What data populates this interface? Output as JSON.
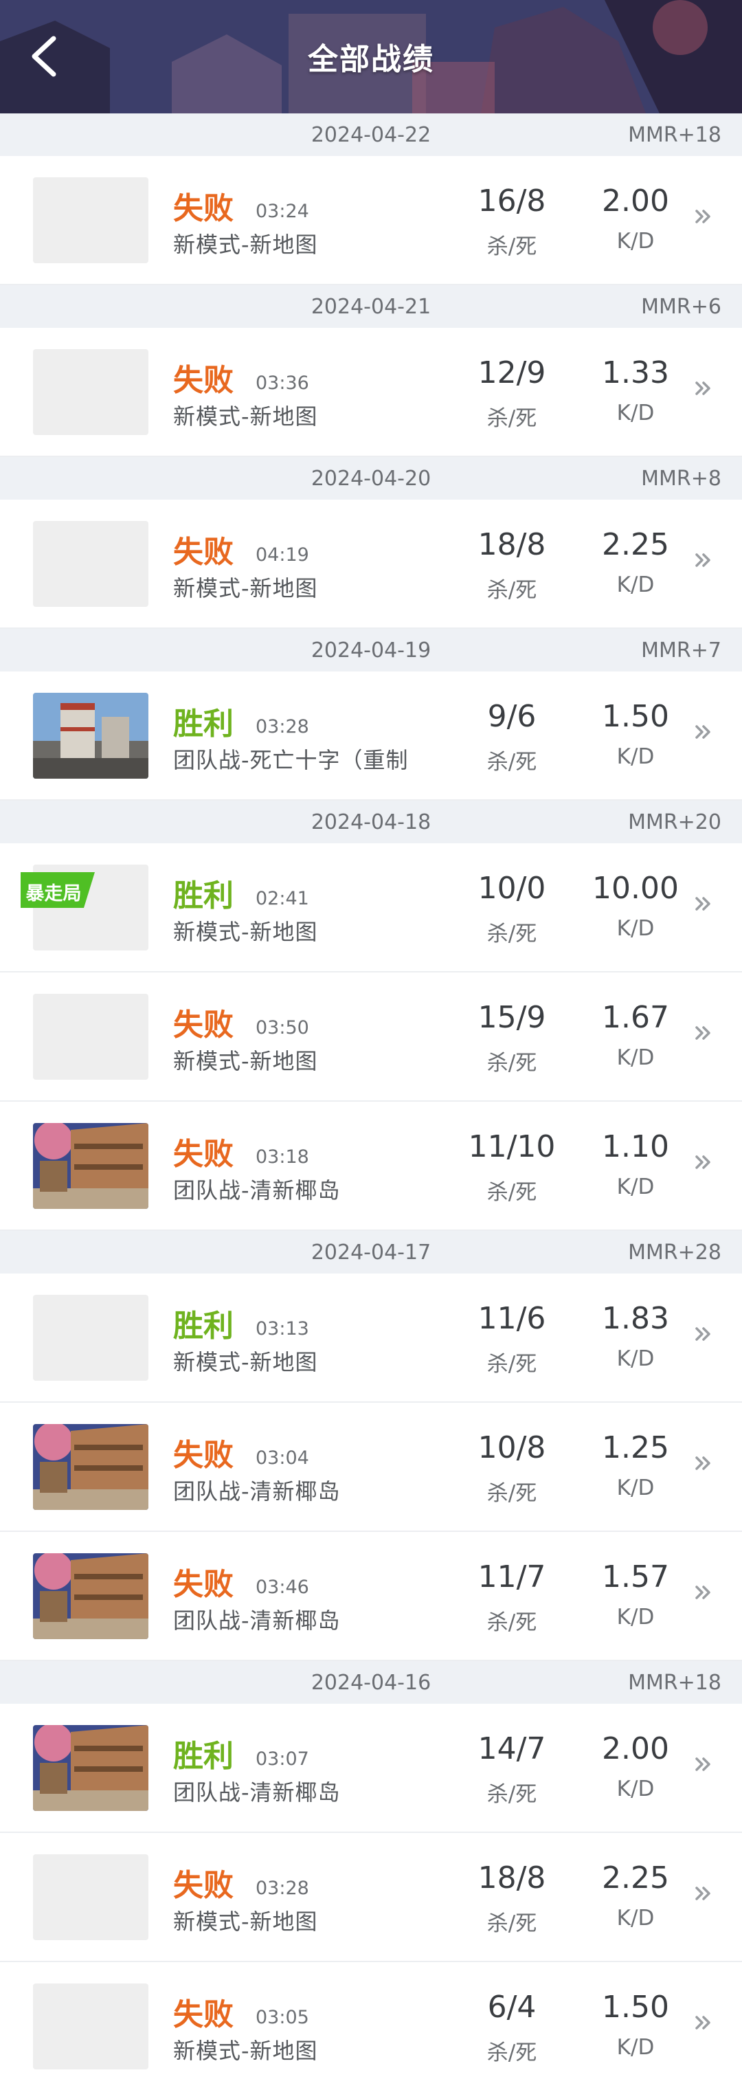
{
  "header": {
    "title": "全部战绩"
  },
  "stat_labels": {
    "kill_death": "杀/死",
    "kd": "K/D"
  },
  "colors": {
    "lose": "#e8681f",
    "win": "#6fb31f",
    "date_bg": "#eef1f5",
    "tag": "#4fbf24"
  },
  "days": [
    {
      "date": "2024-04-22",
      "mmr": "MMR+18",
      "matches": [
        {
          "result": "失败",
          "outcome": "lose",
          "duration": "03:24",
          "map": "新模式-新地图",
          "kd": "16/8",
          "ratio": "2.00",
          "thumb": "blank"
        }
      ]
    },
    {
      "date": "2024-04-21",
      "mmr": "MMR+6",
      "matches": [
        {
          "result": "失败",
          "outcome": "lose",
          "duration": "03:36",
          "map": "新模式-新地图",
          "kd": "12/9",
          "ratio": "1.33",
          "thumb": "blank"
        }
      ]
    },
    {
      "date": "2024-04-20",
      "mmr": "MMR+8",
      "matches": [
        {
          "result": "失败",
          "outcome": "lose",
          "duration": "04:19",
          "map": "新模式-新地图",
          "kd": "18/8",
          "ratio": "2.25",
          "thumb": "blank"
        }
      ]
    },
    {
      "date": "2024-04-19",
      "mmr": "MMR+7",
      "matches": [
        {
          "result": "胜利",
          "outcome": "win",
          "duration": "03:28",
          "map": "团队战-死亡十字（重制",
          "kd": "9/6",
          "ratio": "1.50",
          "thumb": "tower"
        }
      ]
    },
    {
      "date": "2024-04-18",
      "mmr": "MMR+20",
      "matches": [
        {
          "result": "胜利",
          "outcome": "win",
          "duration": "02:41",
          "map": "新模式-新地图",
          "kd": "10/0",
          "ratio": "10.00",
          "thumb": "blank",
          "tag": "暴走局"
        },
        {
          "result": "失败",
          "outcome": "lose",
          "duration": "03:50",
          "map": "新模式-新地图",
          "kd": "15/9",
          "ratio": "1.67",
          "thumb": "blank"
        },
        {
          "result": "失败",
          "outcome": "lose",
          "duration": "03:18",
          "map": "团队战-清新椰岛",
          "kd": "11/10",
          "ratio": "1.10",
          "thumb": "island"
        }
      ]
    },
    {
      "date": "2024-04-17",
      "mmr": "MMR+28",
      "matches": [
        {
          "result": "胜利",
          "outcome": "win",
          "duration": "03:13",
          "map": "新模式-新地图",
          "kd": "11/6",
          "ratio": "1.83",
          "thumb": "blank"
        },
        {
          "result": "失败",
          "outcome": "lose",
          "duration": "03:04",
          "map": "团队战-清新椰岛",
          "kd": "10/8",
          "ratio": "1.25",
          "thumb": "island"
        },
        {
          "result": "失败",
          "outcome": "lose",
          "duration": "03:46",
          "map": "团队战-清新椰岛",
          "kd": "11/7",
          "ratio": "1.57",
          "thumb": "island"
        }
      ]
    },
    {
      "date": "2024-04-16",
      "mmr": "MMR+18",
      "matches": [
        {
          "result": "胜利",
          "outcome": "win",
          "duration": "03:07",
          "map": "团队战-清新椰岛",
          "kd": "14/7",
          "ratio": "2.00",
          "thumb": "island"
        },
        {
          "result": "失败",
          "outcome": "lose",
          "duration": "03:28",
          "map": "新模式-新地图",
          "kd": "18/8",
          "ratio": "2.25",
          "thumb": "blank"
        },
        {
          "result": "失败",
          "outcome": "lose",
          "duration": "03:05",
          "map": "新模式-新地图",
          "kd": "6/4",
          "ratio": "1.50",
          "thumb": "blank"
        }
      ]
    }
  ]
}
